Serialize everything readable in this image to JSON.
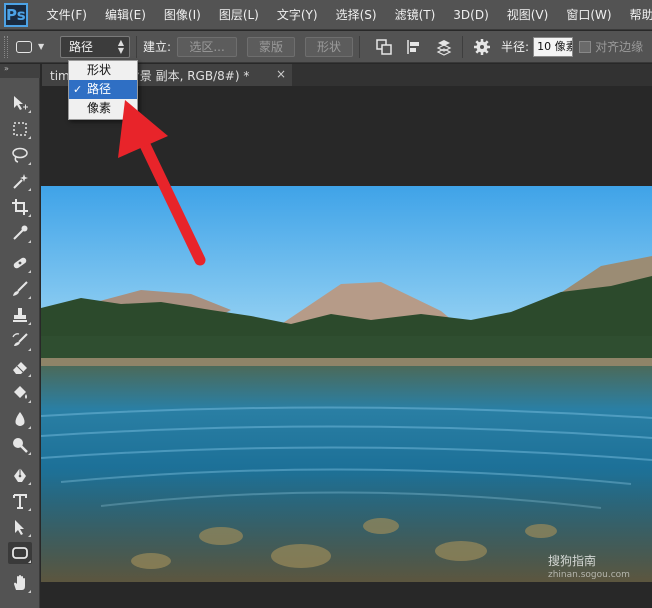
{
  "app": {
    "logo": "Ps"
  },
  "menu": [
    "文件(F)",
    "编辑(E)",
    "图像(I)",
    "图层(L)",
    "文字(Y)",
    "选择(S)",
    "滤镜(T)",
    "3D(D)",
    "视图(V)",
    "窗口(W)",
    "帮助(H)"
  ],
  "options": {
    "mode_value": "路径",
    "make_label": "建立:",
    "selection_btn": "选区...",
    "mask_btn": "蒙版",
    "shape_btn": "形状",
    "radius_label": "半径:",
    "radius_value": "10 像素",
    "align_edges_label": "对齐边缘"
  },
  "dropdown": {
    "items": [
      {
        "label": "形状",
        "selected": false
      },
      {
        "label": "路径",
        "selected": true
      },
      {
        "label": "像素",
        "selected": false
      }
    ],
    "check": "✓"
  },
  "document": {
    "tab_title": "tim          % (背景 副本, RGB/8#) *",
    "close": "×"
  },
  "watermark": {
    "text": "搜狗指南",
    "sub": "zhinan.sogou.com"
  },
  "colors": {
    "accent": "#2f6fc4",
    "ps_blue": "#4da3e6",
    "arrow": "#e8242a"
  },
  "tools": [
    "move-icon",
    "marquee-icon",
    "lasso-icon",
    "magic-wand-icon",
    "crop-icon",
    "eyedropper-icon",
    "healing-icon",
    "brush-icon",
    "stamp-icon",
    "history-brush-icon",
    "eraser-icon",
    "bucket-icon",
    "blur-icon",
    "dodge-icon",
    "pen-icon",
    "type-icon",
    "path-select-icon",
    "rounded-rect-icon",
    "hand-icon"
  ]
}
